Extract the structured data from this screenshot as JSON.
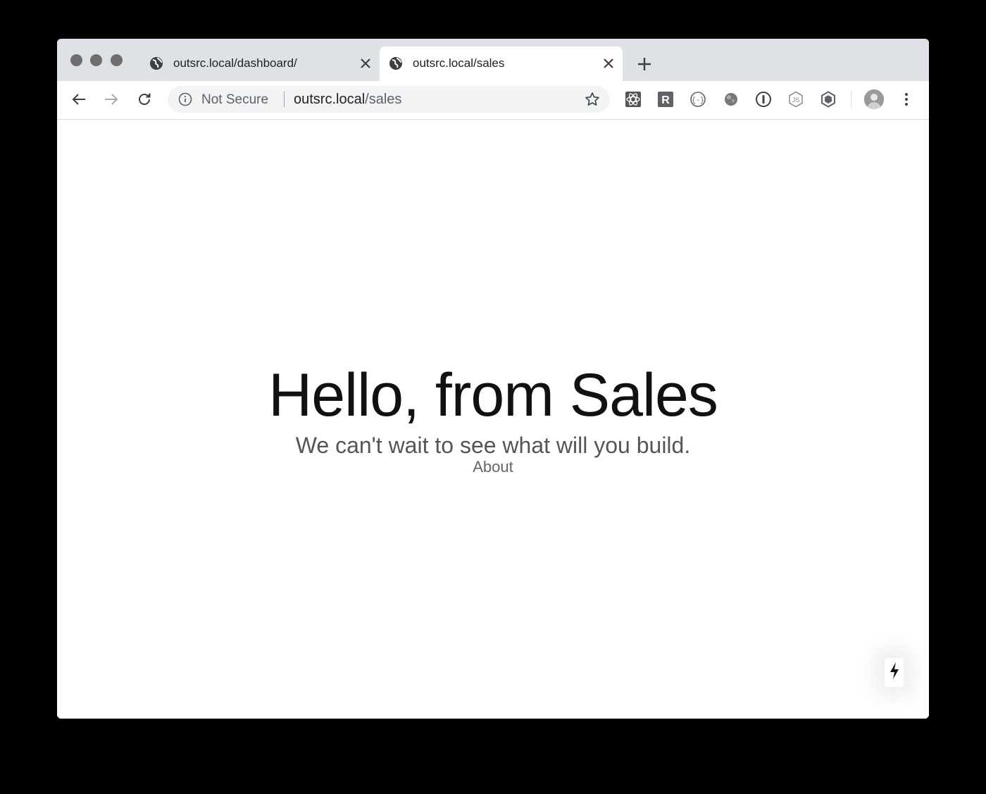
{
  "window": {
    "tabs": [
      {
        "title": "outsrc.local/dashboard/",
        "icon": "globe-icon",
        "active": false
      },
      {
        "title": "outsrc.local/sales",
        "icon": "globe-icon",
        "active": true
      }
    ]
  },
  "toolbar": {
    "security_label": "Not Secure",
    "url_host": "outsrc.local",
    "url_path": "/sales",
    "extensions": [
      "react-devtools-icon",
      "r-extension-icon",
      "json-viewer-icon",
      "ball-extension-icon",
      "onepassword-icon",
      "nodejs-icon",
      "hexagon-extension-icon"
    ]
  },
  "page": {
    "heading": "Hello, from Sales",
    "subheading": "We can't wait to see what will you build.",
    "about_link": "About"
  },
  "colors": {
    "tabstrip": "#dee1e6",
    "omnibox": "#f1f3f4",
    "heading": "#111111",
    "subtext": "#555555"
  }
}
